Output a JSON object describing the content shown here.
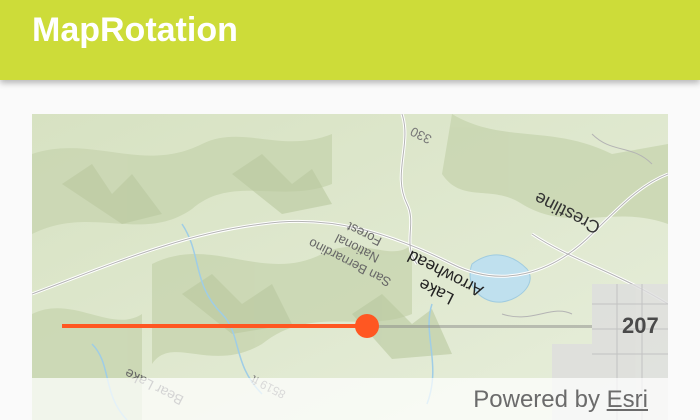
{
  "app": {
    "title": "MapRotation"
  },
  "map": {
    "rotation_degrees": 207,
    "labels": {
      "lake_line1": "Lake",
      "lake_line2": "Arrowhead",
      "forest_line1": "San Bernardino",
      "forest_line2": "National",
      "forest_line3": "Forest",
      "crestline": "Crestline",
      "route": "330",
      "bear": "Bear Lake",
      "elevation": "8519 ft"
    },
    "attribution": {
      "prefix": "Powered by ",
      "link": "Esri"
    }
  },
  "slider": {
    "value": "207",
    "min": 0,
    "max": 360
  },
  "colors": {
    "app_bar": "#cddc39",
    "slider_accent": "#ff5722"
  }
}
